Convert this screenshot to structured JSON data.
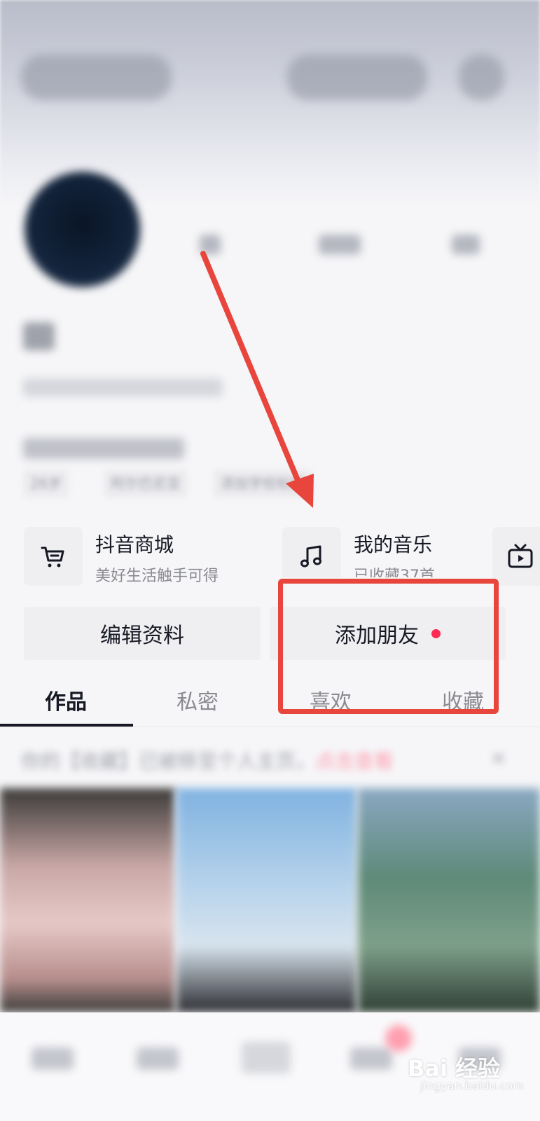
{
  "services": [
    {
      "title": "抖音商城",
      "subtitle": "美好生活触手可得",
      "icon": "cart-icon"
    },
    {
      "title": "我的音乐",
      "subtitle": "已收藏37首",
      "icon": "music-note-icon"
    },
    {
      "title": "",
      "subtitle": "",
      "icon": "tv-icon"
    }
  ],
  "buttons": {
    "edit_profile": "编辑资料",
    "add_friend": "添加朋友"
  },
  "tabs": [
    "作品",
    "私密",
    "喜欢",
    "收藏"
  ],
  "profile": {
    "age_tag": "26岁",
    "location_tag": "阿尔巴尼亚",
    "school_tag": "添加学校标签"
  },
  "notice": {
    "text": "你的【收藏】已被移至个人主页，",
    "action": "点击查看"
  },
  "watermark": {
    "brand": "Bai 经验",
    "url": "jingyan.baidu.com"
  },
  "colors": {
    "accent_red": "#fe2c55",
    "annotation": "#e8453c"
  }
}
